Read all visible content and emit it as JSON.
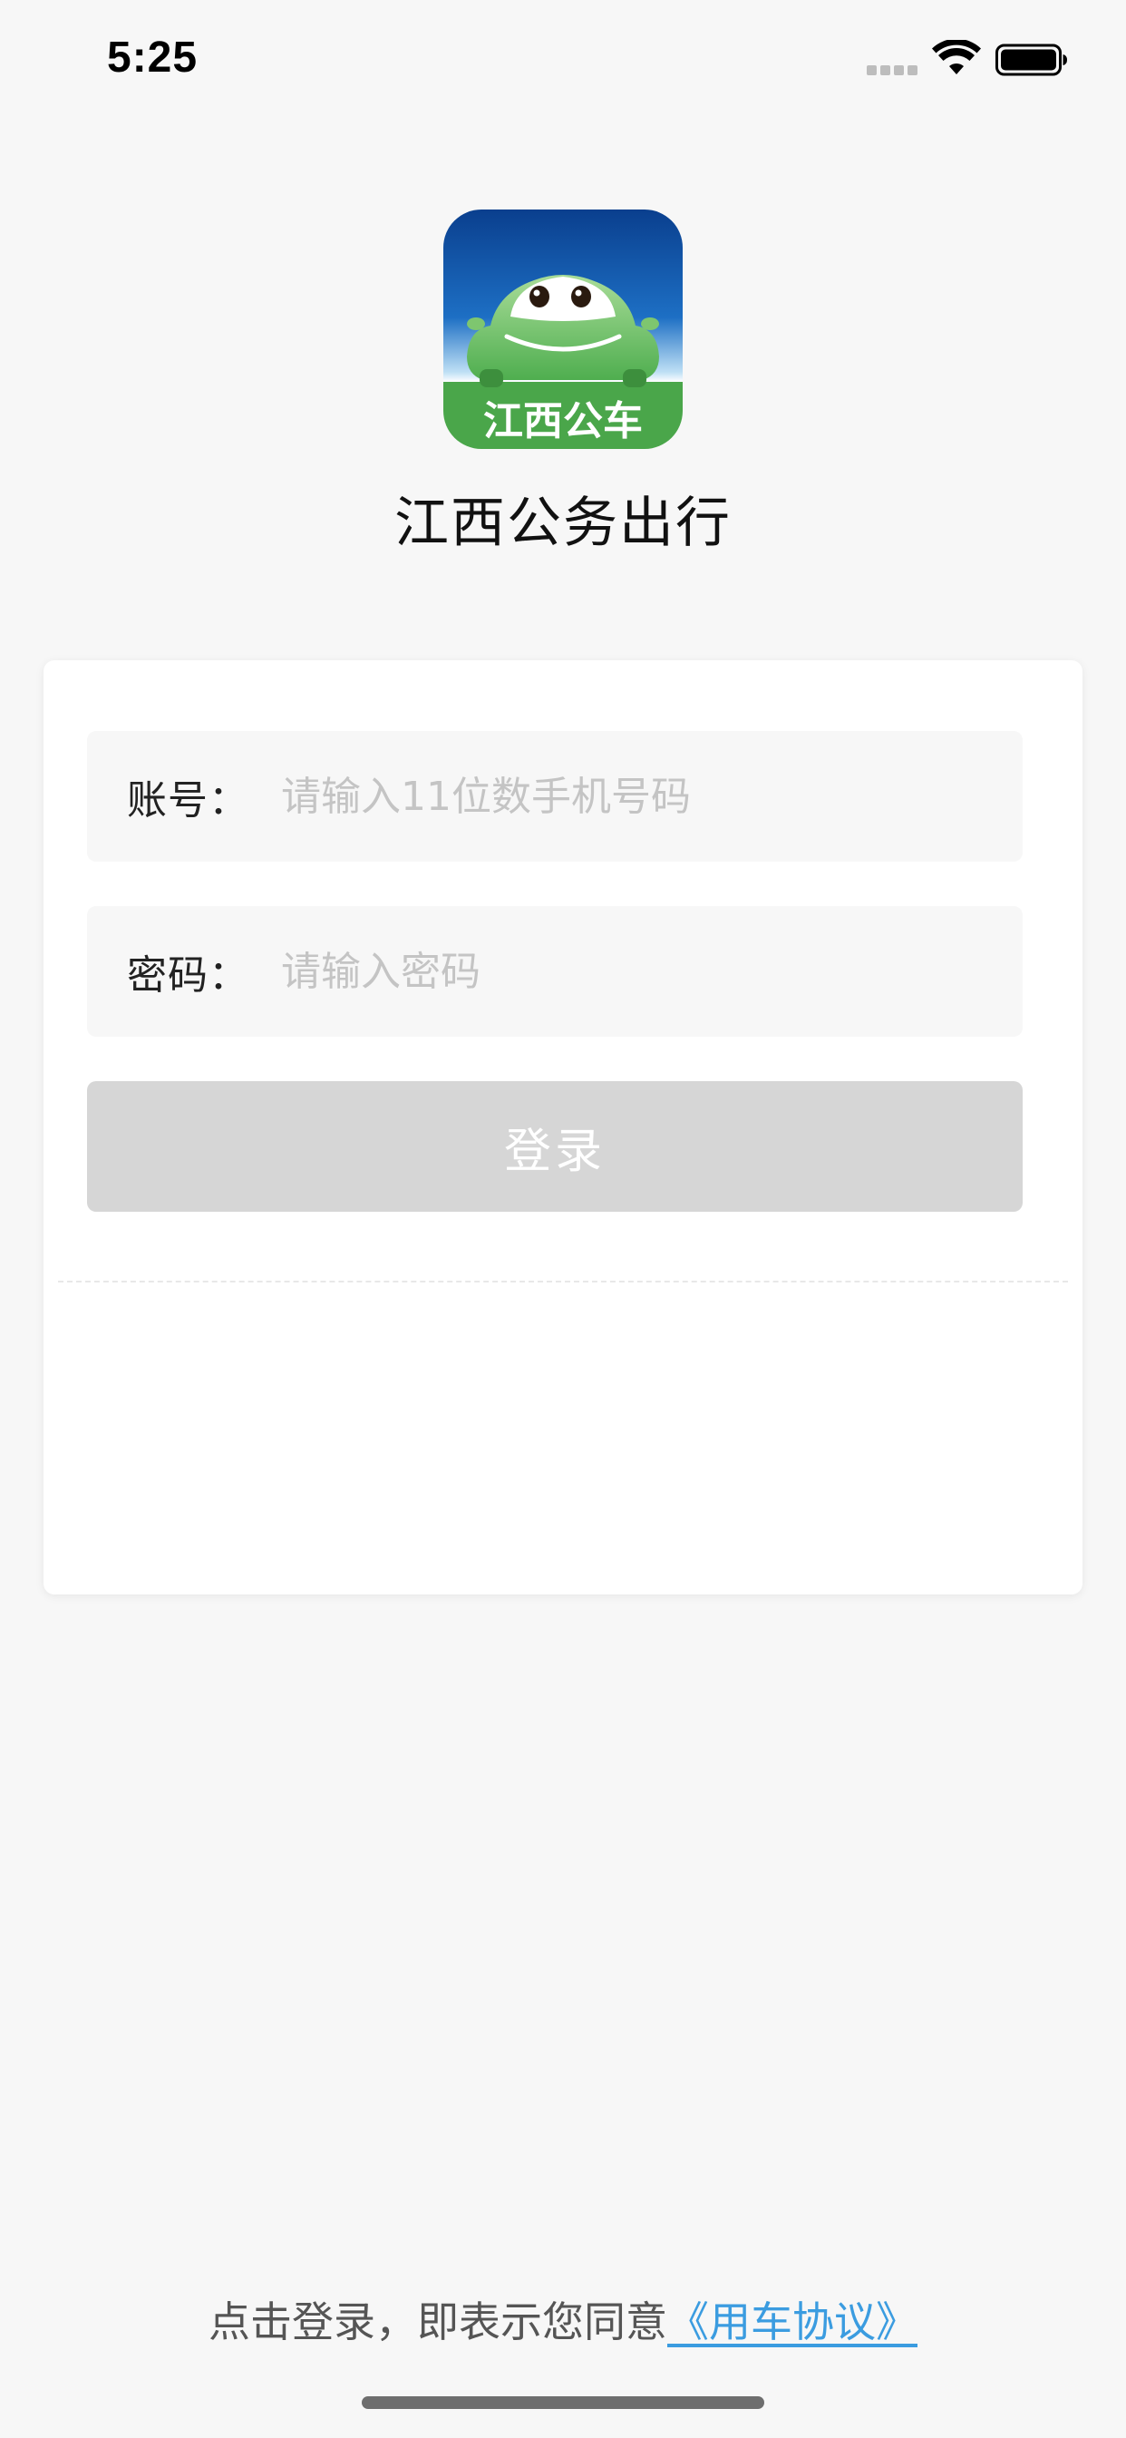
{
  "status_bar": {
    "time": "5:25",
    "signal_icon": "cellular-signal-dots-icon",
    "wifi_icon": "wifi-icon",
    "battery_icon": "battery-full-icon"
  },
  "app": {
    "logo_icon": "jiangxi-gongche-car-logo",
    "logo_text": "江西公车",
    "name": "江西公务出行"
  },
  "login_form": {
    "account": {
      "label": "账号：",
      "value": "",
      "placeholder": "请输入11位数手机号码"
    },
    "password": {
      "label": "密码：",
      "value": "",
      "placeholder": "请输入密码"
    },
    "login_button": "登录"
  },
  "footer": {
    "agreement_prefix": "点击登录，即表示您同意",
    "agreement_link": "《用车协议》"
  },
  "colors": {
    "page_background": "#f7f7f7",
    "card_background": "#ffffff",
    "input_background": "#f7f7f7",
    "button_disabled": "#d6d6d6",
    "link": "#3b9ce0",
    "logo_blue": "#0d4f9e",
    "logo_green": "#4aa64a"
  }
}
